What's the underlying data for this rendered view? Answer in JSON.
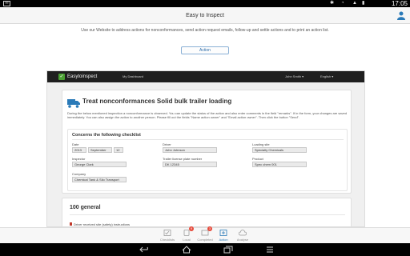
{
  "statusbar": {
    "time": "17:05"
  },
  "app": {
    "title": "Easy to Inspect"
  },
  "intro": {
    "text": "Use our Website to address actions for nonconformances, send action request emails, follow-up and settle actions and to print an action list."
  },
  "action_button": "Action",
  "site": {
    "brand": "Easytoinspect",
    "dashboard": "My Dashboard",
    "user": "John Smith",
    "language": "English"
  },
  "card": {
    "title": "Treat nonconformances Solid bulk trailer loading",
    "description": "During the below mentioned inspection a nonconformance is observed. You can update the status of the action and also enter comments in the field \"remarks\". If in the form, your changes are saved immediately. You can also assign the action to another person. Please fill out the fields \"Name action owner\" and \"Email action owner\". Then click the button \"Send\"."
  },
  "checklist": {
    "title": "Concerns the following checklist",
    "fields": {
      "date": {
        "label": "Date",
        "year": "2013",
        "month": "September",
        "day": "12"
      },
      "driver": {
        "label": "Driver",
        "value": "John Johnson"
      },
      "loading_site": {
        "label": "Loading site",
        "value": "Specialty Chemicals"
      },
      "inspector": {
        "label": "Inspector",
        "value": "George Clark"
      },
      "trailer": {
        "label": "Trailer license plate number",
        "value": "DK 12345"
      },
      "product": {
        "label": "Product",
        "value": "Spec chem 001"
      },
      "company": {
        "label": "Company",
        "value": "Chemical Tank & Silo Transport"
      }
    }
  },
  "section2": {
    "title": "100 general",
    "item": "Driver received site (safety) instructions"
  },
  "tabs": [
    {
      "label": "Checklists",
      "badge": ""
    },
    {
      "label": "Local",
      "badge": "9"
    },
    {
      "label": "Completed",
      "badge": "3"
    },
    {
      "label": "Action",
      "badge": ""
    },
    {
      "label": "Analyse",
      "badge": ""
    }
  ],
  "colors": {
    "accent": "#2a7ab8",
    "brand_green": "#4aa032",
    "nav_dark": "#1f1f1f",
    "badge": "#e64a3b"
  }
}
